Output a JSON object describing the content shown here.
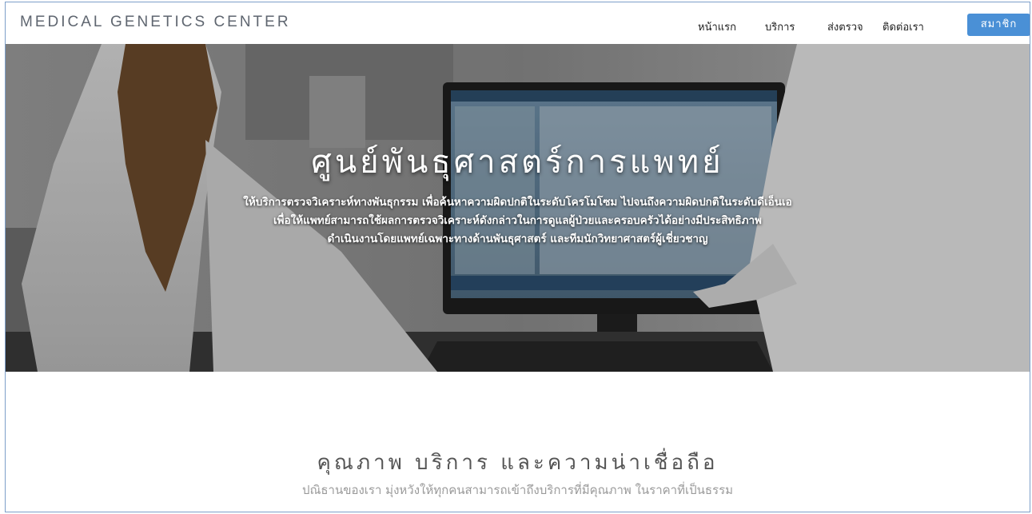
{
  "brand": "MEDICAL GENETICS CENTER",
  "nav": {
    "items": [
      "หน้าแรก",
      "บริการ",
      "ส่งตรวจ",
      "ติดต่อเรา"
    ],
    "member_label": "สมาชิก"
  },
  "hero": {
    "title": "ศูนย์พันธุศาสตร์การแพทย์",
    "lines": [
      "ให้บริการตรวจวิเคราะห์ทางพันธุกรรม เพื่อค้นหาความผิดปกติในระดับโครโมโซม ไปจนถึงความผิดปกติในระดับดีเอ็นเอ",
      "เพื่อให้แพทย์สามารถใช้ผลการตรวจวิเคราะห์ดังกล่าวในการดูแลผู้ป่วยและครอบครัวได้อย่างมีประสิทธิภาพ",
      "ดำเนินงานโดยแพทย์เฉพาะทางด้านพันธุศาสตร์ และทีมนักวิทยาศาสตร์ผู้เชี่ยวชาญ"
    ]
  },
  "section": {
    "title": "คุณภาพ บริการ และความน่าเชื่อถือ",
    "subtitle": "ปณิธานของเรา มุ่งหวังให้ทุกคนสามารถเข้าถึงบริการที่มีคุณภาพ ในราคาที่เป็นธรรม"
  },
  "colors": {
    "accent": "#4a90d6",
    "frame_border": "#7d9fc9"
  }
}
